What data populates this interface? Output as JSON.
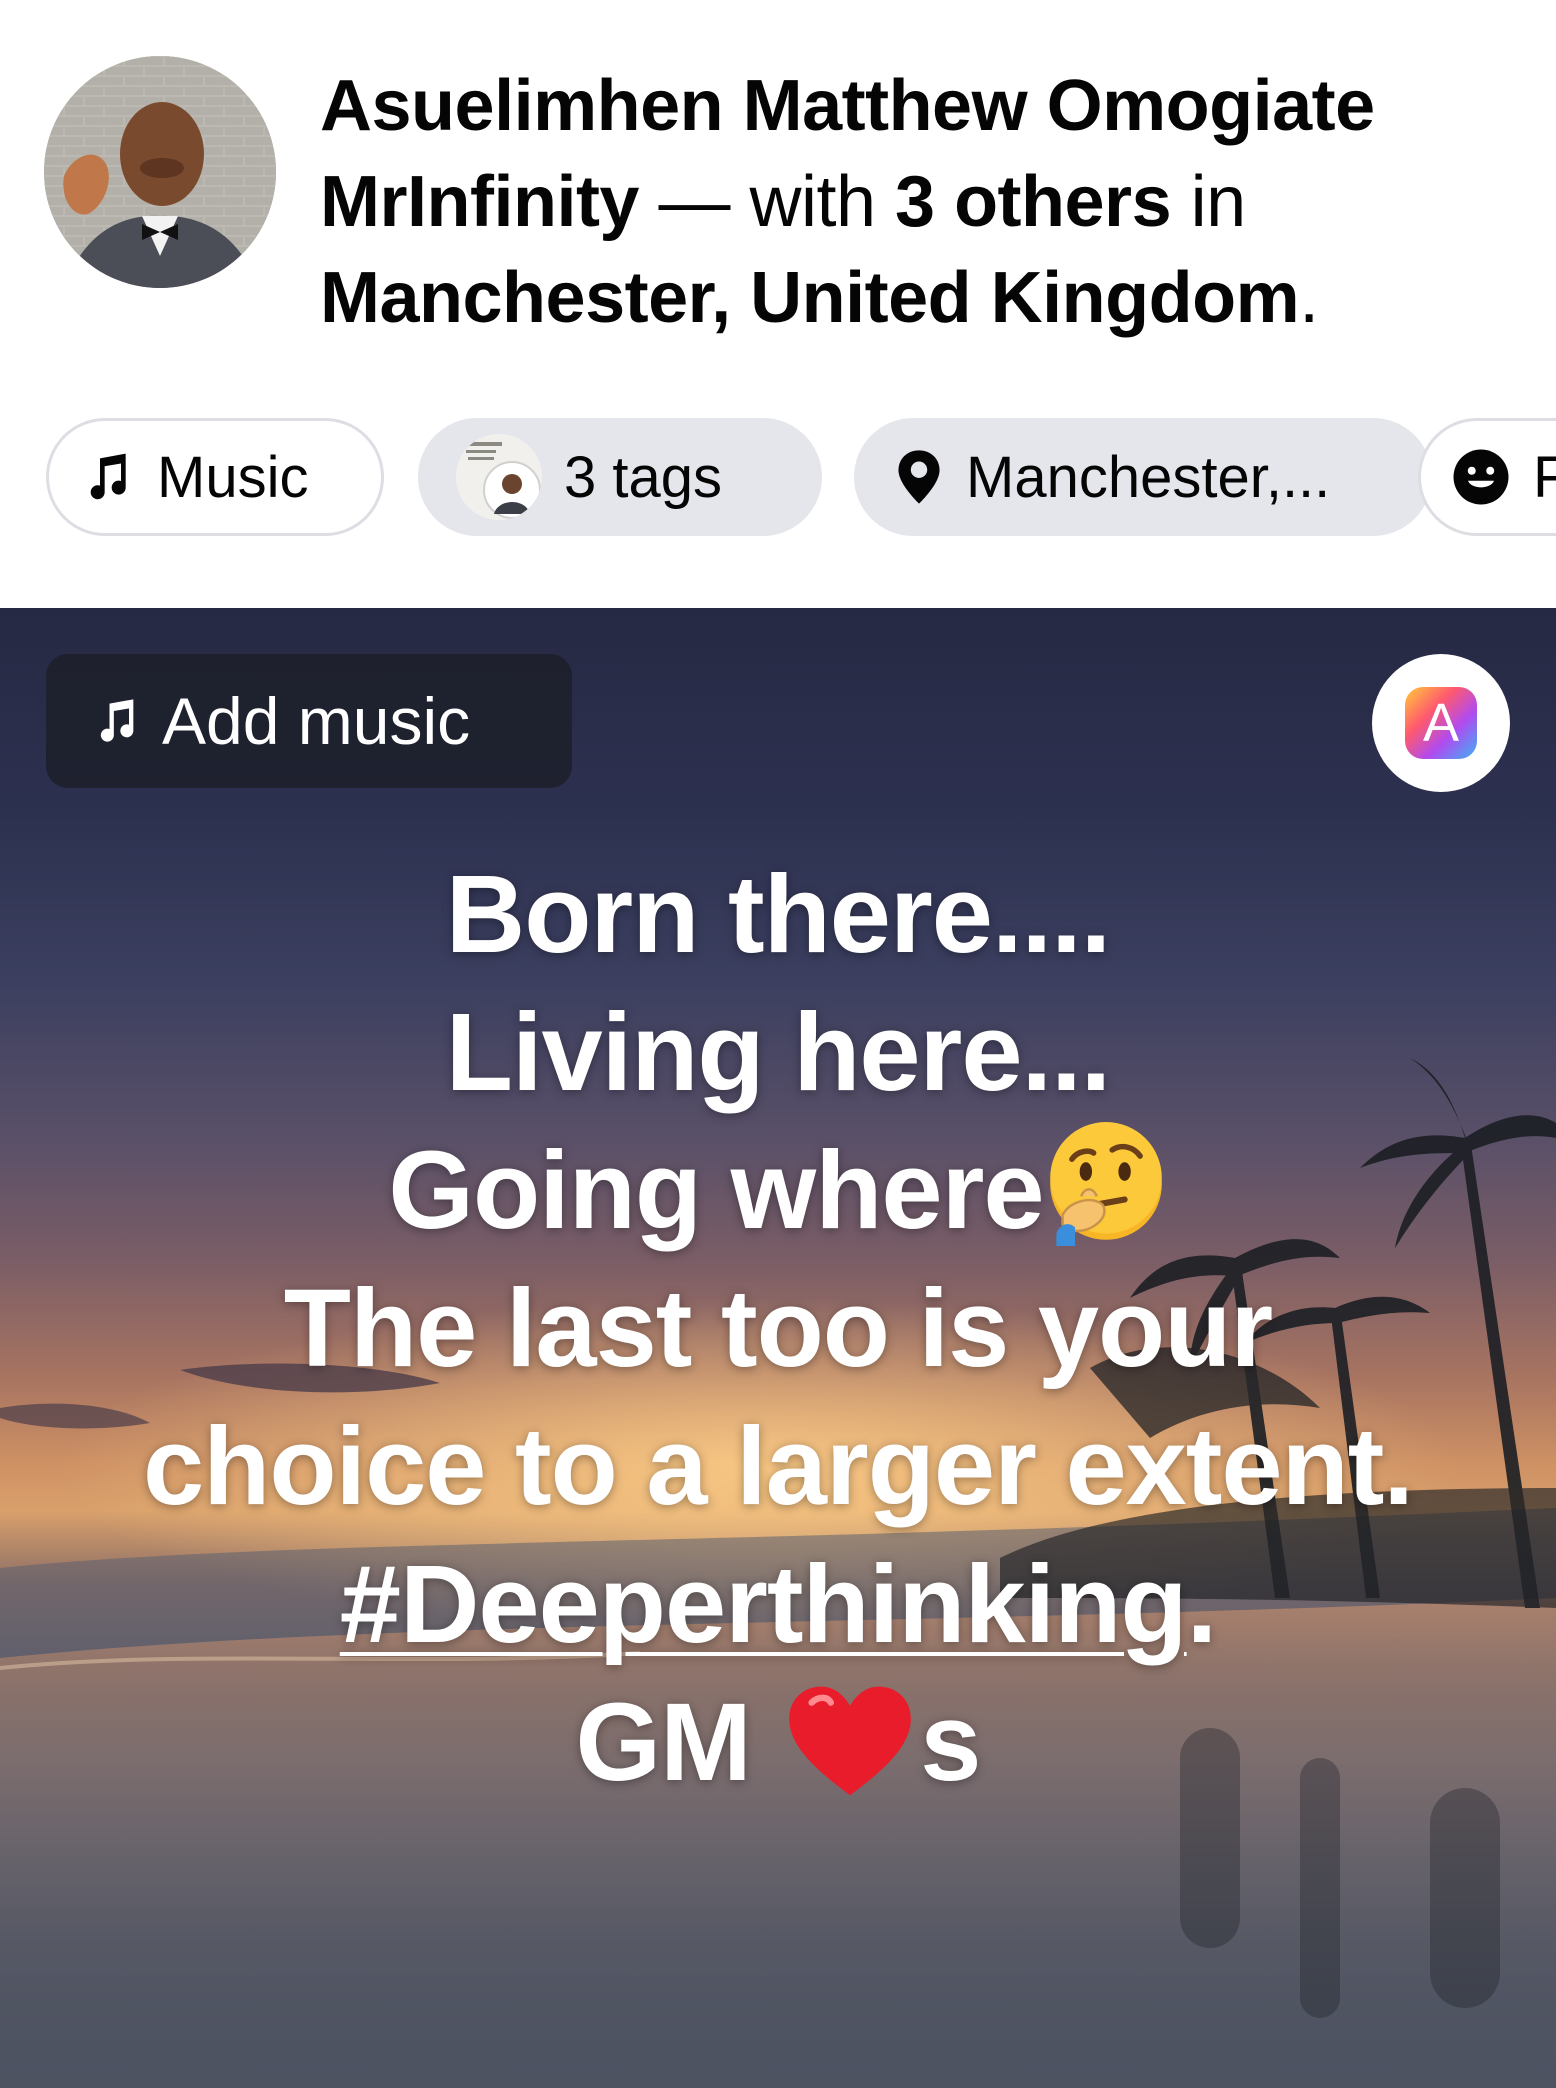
{
  "header": {
    "author_name": "Asuelimhen Matthew Omogiate MrInfinity",
    "dash": " — with ",
    "others": "3 others",
    "in_word": " in ",
    "location": "Manchester, United Kingdom",
    "period": "."
  },
  "chips": {
    "music": {
      "label": "Music",
      "icon": "music-note-icon"
    },
    "tags": {
      "label": "3 tags",
      "icon": "tagged-people-avatar"
    },
    "location": {
      "label": "Manchester,...",
      "icon": "location-pin-icon"
    },
    "feeling": {
      "label": "F",
      "icon": "smiley-icon"
    }
  },
  "post": {
    "add_music_label": "Add music",
    "text_style_letter": "A",
    "lines": {
      "l1": "Born there....",
      "l2": "Living here...",
      "l3": "Going where",
      "l4": "The last too is your",
      "l5": "choice to a larger extent.",
      "l6_hashtag": "#Deeperthinking",
      "l6_suffix": ".",
      "l7_prefix": "GM ",
      "l7_suffix": "s"
    },
    "emoji_thinking": "thinking-face-emoji",
    "emoji_heart": "red-heart-emoji"
  },
  "colors": {
    "text_primary": "#050505",
    "chip_fill": "#e4e6eb",
    "chip_border": "#dcdee3"
  }
}
